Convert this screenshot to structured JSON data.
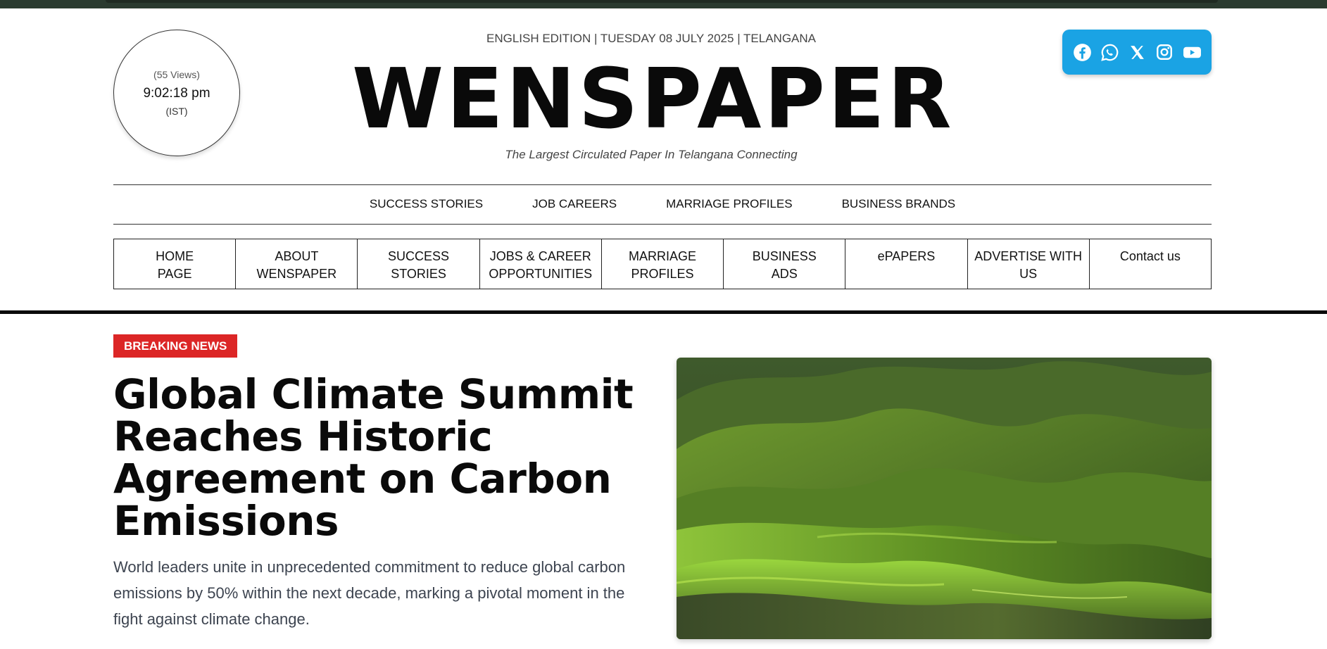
{
  "header": {
    "views": "(55 Views)",
    "time": "9:02:18 pm",
    "timezone": "(IST)",
    "edition": "ENGLISH EDITION | TUESDAY 08 JULY 2025 | TELANGANA",
    "masthead": "WENSPAPER",
    "tagline": "The Largest Circulated Paper In Telangana Connecting"
  },
  "social": {
    "icons": [
      "facebook-icon",
      "whatsapp-icon",
      "x-icon",
      "instagram-icon",
      "youtube-icon"
    ],
    "background": "#1aa3e4"
  },
  "subnav": {
    "items": [
      "SUCCESS STORIES",
      "JOB CAREERS",
      "MARRIAGE PROFILES",
      "BUSINESS BRANDS"
    ]
  },
  "mainnav": {
    "items": [
      {
        "line1": "HOME",
        "line2": "PAGE"
      },
      {
        "line1": "ABOUT",
        "line2": "WENSPAPER"
      },
      {
        "line1": "SUCCESS",
        "line2": "STORIES"
      },
      {
        "line1": "JOBS & CAREER",
        "line2": "OPPORTUNITIES"
      },
      {
        "line1": "MARRIAGE",
        "line2": "PROFILES"
      },
      {
        "line1": "BUSINESS",
        "line2": "ADS"
      },
      {
        "line1": "ePAPERS",
        "line2": ""
      },
      {
        "line1": "ADVERTISE WITH",
        "line2": "US"
      },
      {
        "line1": "Contact us",
        "line2": ""
      }
    ]
  },
  "article": {
    "badge": "BREAKING NEWS",
    "badge_color": "#dc2626",
    "headline": "Global Climate Summit Reaches Historic Agreement on Carbon Emissions",
    "summary": "World leaders unite in unprecedented commitment to reduce global carbon emissions by 50% within the next decade, marking a pivotal moment in the fight against climate change."
  }
}
